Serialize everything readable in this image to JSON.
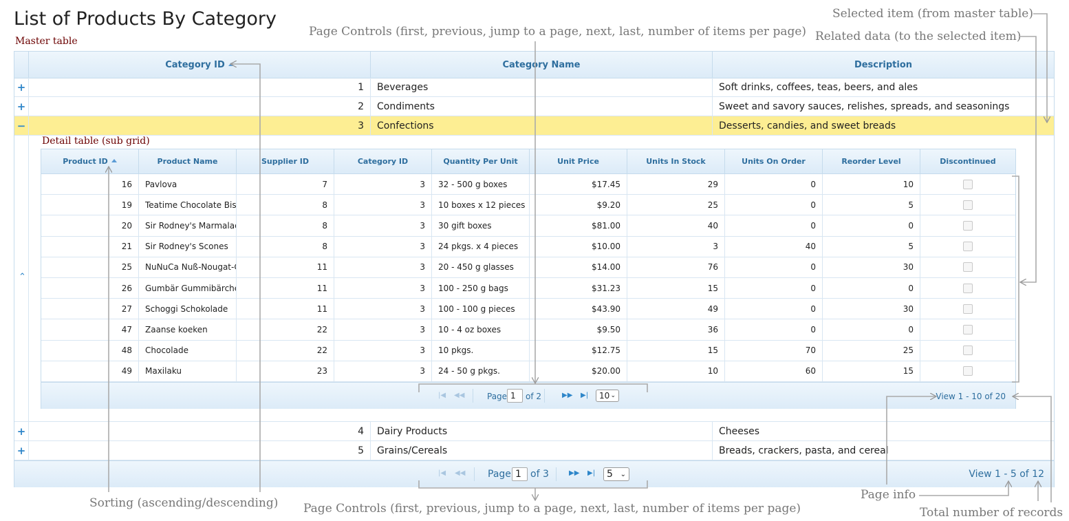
{
  "page": {
    "title": "List of Products By Category"
  },
  "captions": {
    "master": "Master table",
    "detail": "Detail table (sub grid)"
  },
  "annotations": {
    "selected_item": "Selected item (from master table)",
    "related_data": "Related data (to the selected item)",
    "page_controls_top": "Page Controls (first, previous, jump to a page, next, last, number of items per page)",
    "page_controls_bottom": "Page Controls (first, previous, jump to a page, next, last, number of items per page)",
    "sorting": "Sorting (ascending/descending)",
    "page_info": "Page info",
    "total_records": "Total number of records"
  },
  "master": {
    "columns": [
      "Category ID",
      "Category Name",
      "Description"
    ],
    "rows_before": [
      {
        "expander": "+",
        "id": "1",
        "name": "Beverages",
        "description": "Soft drinks, coffees, teas, beers, and ales"
      },
      {
        "expander": "+",
        "id": "2",
        "name": "Condiments",
        "description": "Sweet and savory sauces, relishes, spreads, and seasonings"
      }
    ],
    "selected_row": {
      "expander": "−",
      "id": "3",
      "name": "Confections",
      "description": "Desserts, candies, and sweet breads"
    },
    "rows_after": [
      {
        "expander": "+",
        "id": "4",
        "name": "Dairy Products",
        "description": "Cheeses"
      },
      {
        "expander": "+",
        "id": "5",
        "name": "Grains/Cereals",
        "description": "Breads, crackers, pasta, and cereal"
      }
    ],
    "pager": {
      "page_label": "Page",
      "page_value": "1",
      "of_label": "of 3",
      "rows_per_page": "5",
      "info": "View 1 - 5 of 12"
    }
  },
  "detail": {
    "columns": [
      "Product ID",
      "Product Name",
      "Supplier ID",
      "Category ID",
      "Quantity Per Unit",
      "Unit Price",
      "Units In Stock",
      "Units On Order",
      "Reorder Level",
      "Discontinued"
    ],
    "rows": [
      [
        "16",
        "Pavlova",
        "7",
        "3",
        "32 - 500 g boxes",
        "$17.45",
        "29",
        "0",
        "10"
      ],
      [
        "19",
        "Teatime Chocolate Biscuits",
        "8",
        "3",
        "10 boxes x 12 pieces",
        "$9.20",
        "25",
        "0",
        "5"
      ],
      [
        "20",
        "Sir Rodney's Marmalade",
        "8",
        "3",
        "30 gift boxes",
        "$81.00",
        "40",
        "0",
        "0"
      ],
      [
        "21",
        "Sir Rodney's Scones",
        "8",
        "3",
        "24 pkgs. x 4 pieces",
        "$10.00",
        "3",
        "40",
        "5"
      ],
      [
        "25",
        "NuNuCa Nuß-Nougat-Creme",
        "11",
        "3",
        "20 - 450 g glasses",
        "$14.00",
        "76",
        "0",
        "30"
      ],
      [
        "26",
        "Gumbär Gummibärchen",
        "11",
        "3",
        "100 - 250 g bags",
        "$31.23",
        "15",
        "0",
        "0"
      ],
      [
        "27",
        "Schoggi Schokolade",
        "11",
        "3",
        "100 - 100 g pieces",
        "$43.90",
        "49",
        "0",
        "30"
      ],
      [
        "47",
        "Zaanse koeken",
        "22",
        "3",
        "10 - 4 oz boxes",
        "$9.50",
        "36",
        "0",
        "0"
      ],
      [
        "48",
        "Chocolade",
        "22",
        "3",
        "10 pkgs.",
        "$12.75",
        "15",
        "70",
        "25"
      ],
      [
        "49",
        "Maxilaku",
        "23",
        "3",
        "24 - 50 g pkgs.",
        "$20.00",
        "10",
        "60",
        "15"
      ]
    ],
    "pager": {
      "page_label": "Page",
      "page_value": "1",
      "of_label": "of 2",
      "rows_per_page": "10",
      "info": "View 1 - 10 of 20"
    }
  },
  "icons": {
    "sort": "sort-asc-icon",
    "expand": "plus-icon",
    "collapse": "minus-icon",
    "subgrid_collapse": "chevron-up-icon"
  },
  "colors": {
    "header_text": "#2e6e9e",
    "selected_row": "#fdee93",
    "border": "#c5dbec",
    "caption": "#6b0000",
    "annotation": "#777777"
  }
}
